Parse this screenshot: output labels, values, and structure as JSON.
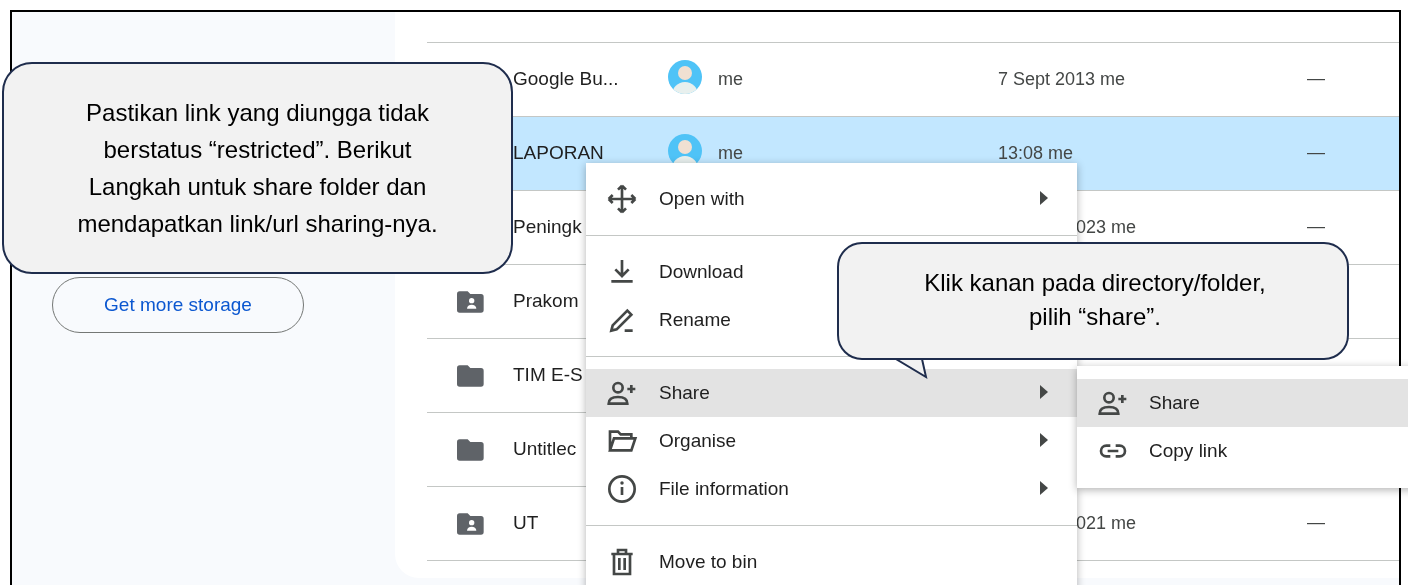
{
  "sidebar": {
    "storage_button": "Get more storage"
  },
  "files": [
    {
      "name": "Google Bu...",
      "owner": "me",
      "modified": "7 Sept 2013 me",
      "size": "—",
      "selected": false
    },
    {
      "name": "LAPORAN",
      "owner": "me",
      "modified": "13:08 me",
      "size": "—",
      "selected": true
    },
    {
      "name": "Peningk",
      "modified_partial": "023 me",
      "size": "—",
      "selected": false
    },
    {
      "name": "Prakom",
      "kind": "shared-folder",
      "selected": false
    },
    {
      "name": "TIM E-S",
      "kind": "folder",
      "selected": false
    },
    {
      "name": "Untitlec",
      "kind": "folder",
      "selected": false
    },
    {
      "name": "UT",
      "kind": "shared-folder",
      "modified_partial": "021 me",
      "size": "—",
      "selected": false
    }
  ],
  "context_menu": [
    {
      "label": "Open with",
      "kind": "move",
      "submenu": true,
      "selected": false,
      "divider_after": true
    },
    {
      "label": "Download",
      "kind": "download",
      "submenu": false,
      "selected": false,
      "divider_after": false
    },
    {
      "label": "Rename",
      "kind": "pencil",
      "submenu": false,
      "selected": false,
      "divider_after": true
    },
    {
      "label": "Share",
      "kind": "person-add",
      "submenu": true,
      "selected": true,
      "divider_after": false
    },
    {
      "label": "Organise",
      "kind": "folder-open",
      "submenu": true,
      "selected": false,
      "divider_after": false
    },
    {
      "label": "File information",
      "kind": "info",
      "submenu": true,
      "selected": false,
      "divider_after": true
    },
    {
      "label": "Move to bin",
      "kind": "trash",
      "submenu": false,
      "selected": false,
      "divider_after": false
    }
  ],
  "share_submenu": [
    {
      "label": "Share",
      "kind": "person-add",
      "selected": true
    },
    {
      "label": "Copy link",
      "kind": "link",
      "selected": false
    }
  ],
  "callouts": [
    {
      "text": "Pastikan link yang diungga tidak berstatus “restricted”. Berikut Langkah untuk share folder dan mendapatkan link/url sharing-nya.",
      "kind": "box"
    },
    {
      "text": "Klik kanan pada directory/folder, pilih “share”.",
      "kind": "pointer"
    }
  ]
}
